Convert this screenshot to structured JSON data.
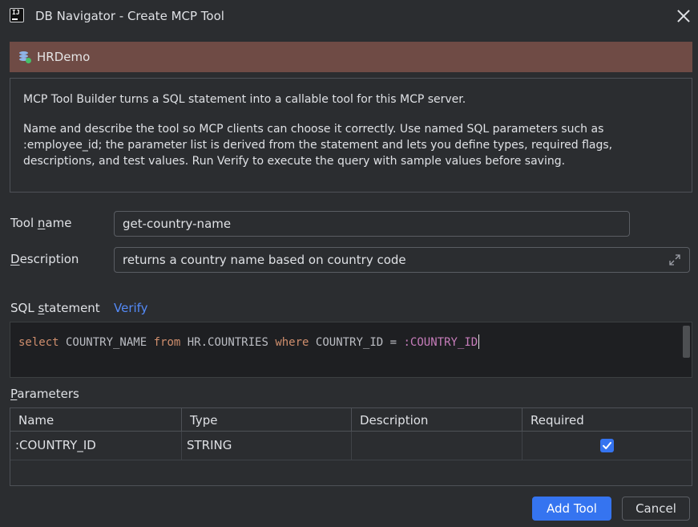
{
  "window": {
    "title": "DB Navigator - Create MCP Tool",
    "app_icon": "intellij-icon",
    "close_icon": "close-icon"
  },
  "connection": {
    "icon": "database-connected-icon",
    "name": "HRDemo",
    "status_color": "#45c16a"
  },
  "info": {
    "paragraph1": "MCP Tool Builder turns a SQL statement into a callable tool for this MCP server.",
    "paragraph2_line1": "Name and describe the tool so MCP clients can choose it correctly. Use named SQL parameters such as",
    "paragraph2_line2": ":employee_id; the parameter list is derived from the statement and lets you define types, required flags,",
    "paragraph2_line3": "descriptions, and test values. Run Verify to execute the query with sample values before saving."
  },
  "form": {
    "tool_name": {
      "label_pre": "Tool ",
      "label_mnemonic": "n",
      "label_post": "ame",
      "value": "get-country-name"
    },
    "description": {
      "label_pre": "",
      "label_mnemonic": "D",
      "label_post": "escription",
      "value": "returns a country name based on country code",
      "expand_icon": "expand-icon"
    },
    "sql": {
      "label_pre": "SQL ",
      "label_mnemonic": "s",
      "label_post": "tatement",
      "verify_label": "Verify"
    }
  },
  "sql_statement": {
    "kw_select": "select",
    "col": " COUNTRY_NAME ",
    "kw_from": "from",
    "table": " HR.COUNTRIES ",
    "kw_where": "where",
    "cond": " COUNTRY_ID = ",
    "param": ":COUNTRY_ID"
  },
  "parameters": {
    "label_mnemonic": "P",
    "label_post": "arameters",
    "columns": [
      "Name",
      "Type",
      "Description",
      "Required"
    ],
    "rows": [
      {
        "name": ":COUNTRY_ID",
        "type": "STRING",
        "description": "",
        "required": true
      }
    ]
  },
  "buttons": {
    "add_tool": "Add Tool",
    "cancel": "Cancel"
  },
  "colors": {
    "accent": "#3574f0",
    "link": "#548af7",
    "connection_bar": "#6f4b45",
    "keyword": "#cf8e6d",
    "sql_param": "#c77dbb"
  }
}
